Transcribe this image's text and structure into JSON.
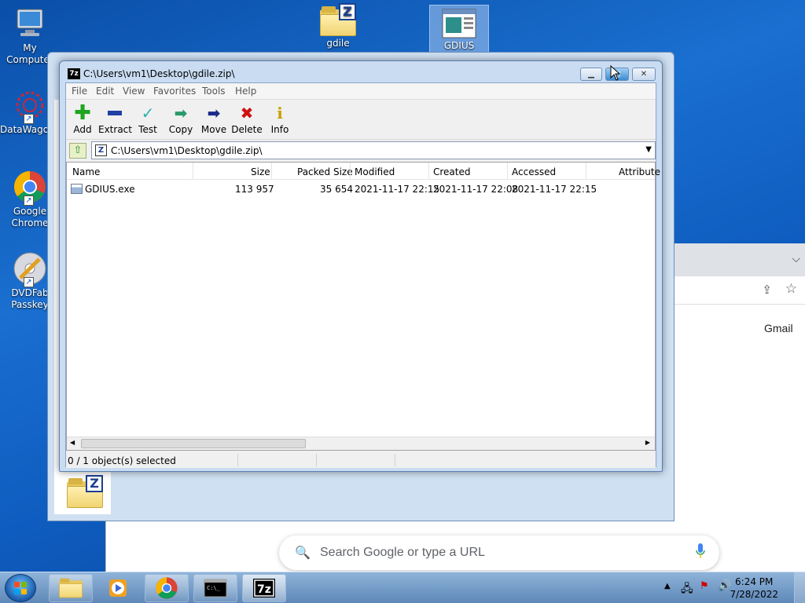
{
  "desktop": {
    "icons": [
      {
        "label": "My Computer"
      },
      {
        "label": "DataWago"
      },
      {
        "label": "Google Chrome"
      },
      {
        "label": "DVDFab Passkey"
      },
      {
        "label": "gdile"
      },
      {
        "label": "GDIUS"
      }
    ]
  },
  "window": {
    "title": "C:\\Users\\vm1\\Desktop\\gdile.zip\\",
    "app_icon": "7z",
    "menu": [
      "File",
      "Edit",
      "View",
      "Favorites",
      "Tools",
      "Help"
    ],
    "toolbar": [
      {
        "label": "Add",
        "icon": "plus-icon",
        "color": "#1fa51f"
      },
      {
        "label": "Extract",
        "icon": "minus-icon",
        "color": "#1f3fa5"
      },
      {
        "label": "Test",
        "icon": "check-icon",
        "color": "#2ab0b0"
      },
      {
        "label": "Copy",
        "icon": "copy-arrow-icon",
        "color": "#2a9a6a"
      },
      {
        "label": "Move",
        "icon": "move-arrow-icon",
        "color": "#1a2a8a"
      },
      {
        "label": "Delete",
        "icon": "x-icon",
        "color": "#d01010"
      },
      {
        "label": "Info",
        "icon": "info-icon",
        "color": "#c9a000"
      }
    ],
    "address": "C:\\Users\\vm1\\Desktop\\gdile.zip\\",
    "columns": [
      "Name",
      "Size",
      "Packed Size",
      "Modified",
      "Created",
      "Accessed",
      "Attribute"
    ],
    "rows": [
      {
        "name": "GDIUS.exe",
        "size": "113 957",
        "packed_size": "35 654",
        "modified": "2021-11-17 22:15",
        "created": "2021-11-17 22:08",
        "accessed": "2021-11-17 22:15"
      }
    ],
    "status": "0 / 1 object(s) selected"
  },
  "chrome": {
    "search_placeholder": "Search Google or type a URL",
    "gmail_link": "Gmail"
  },
  "taskbar": {
    "time": "6:24 PM",
    "date": "7/28/2022"
  }
}
